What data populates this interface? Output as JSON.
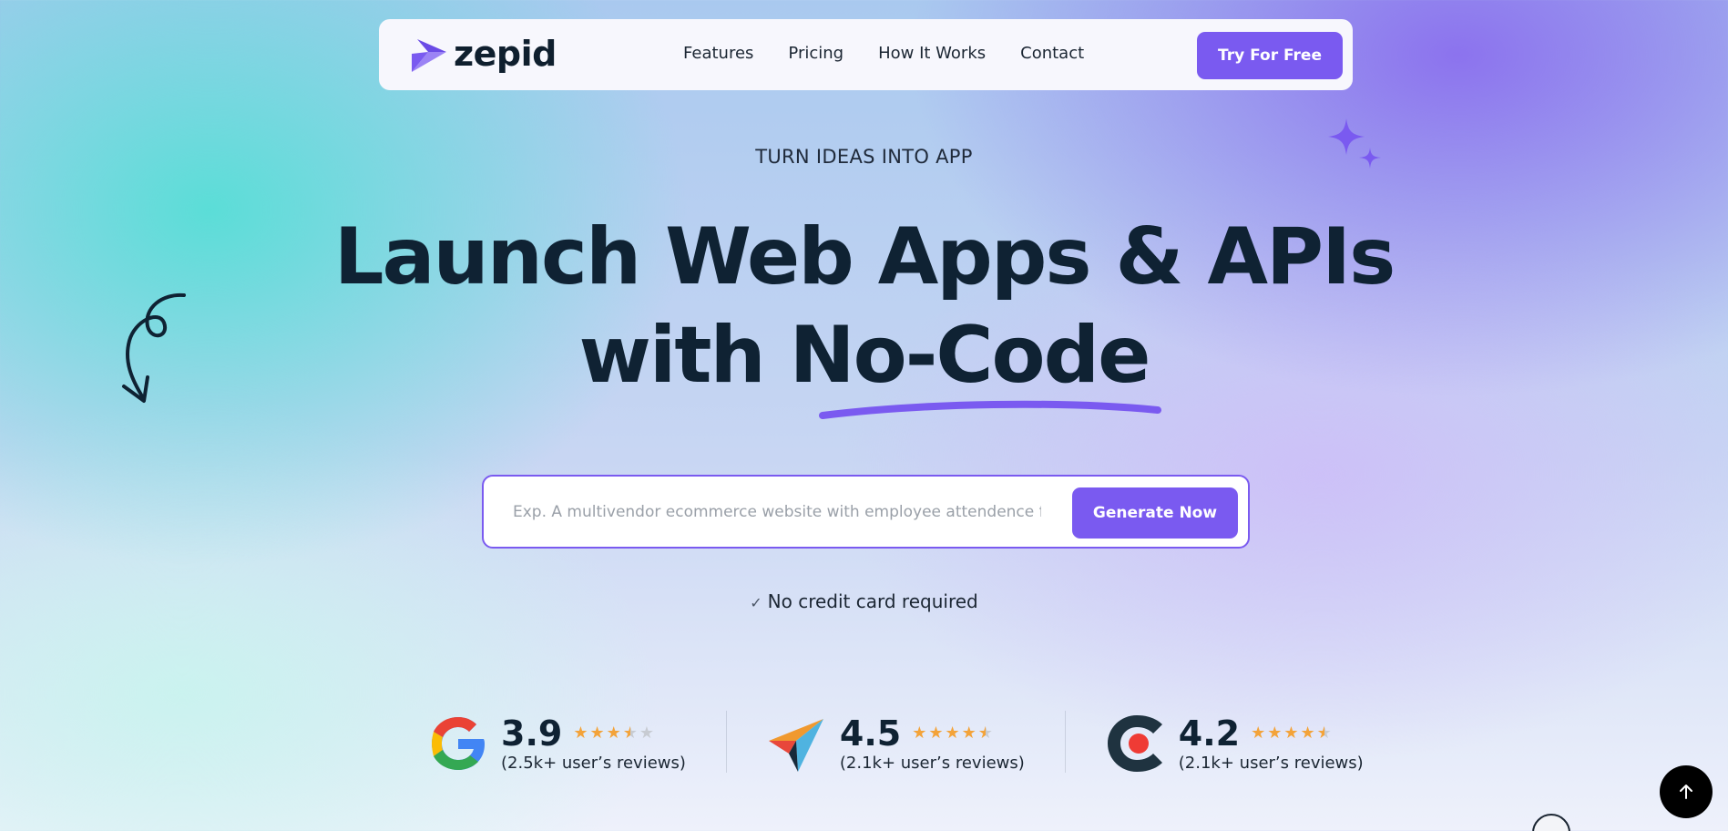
{
  "brand": {
    "name": "zepid",
    "accent": "#7a5af0",
    "logo_icon": "zepid-arrow-logo"
  },
  "nav": {
    "links": [
      "Features",
      "Pricing",
      "How It Works",
      "Contact"
    ],
    "cta": "Try For Free"
  },
  "hero": {
    "eyebrow": "TURN IDEAS INTO APP",
    "headline_line1": "Launch Web Apps & APIs",
    "headline_line2_prefix": "with ",
    "headline_highlight": "No-Code"
  },
  "prompt": {
    "placeholder": "Exp. A multivendor ecommerce website with employee attendence fo",
    "value": "",
    "button": "Generate Now"
  },
  "note": {
    "icon": "check-icon",
    "text": "No credit card required"
  },
  "ratings": [
    {
      "source_icon": "google-logo-icon",
      "score": "3.9",
      "stars": 3.5,
      "reviews": "(2.5k+ user’s reviews)"
    },
    {
      "source_icon": "product-logo-icon",
      "score": "4.5",
      "stars": 4.5,
      "reviews": "(2.1k+ user’s reviews)"
    },
    {
      "source_icon": "capterra-logo-icon",
      "score": "4.2",
      "stars": 4.5,
      "reviews": "(2.1k+ user’s reviews)"
    }
  ],
  "scroll_top_icon": "arrow-up-icon"
}
